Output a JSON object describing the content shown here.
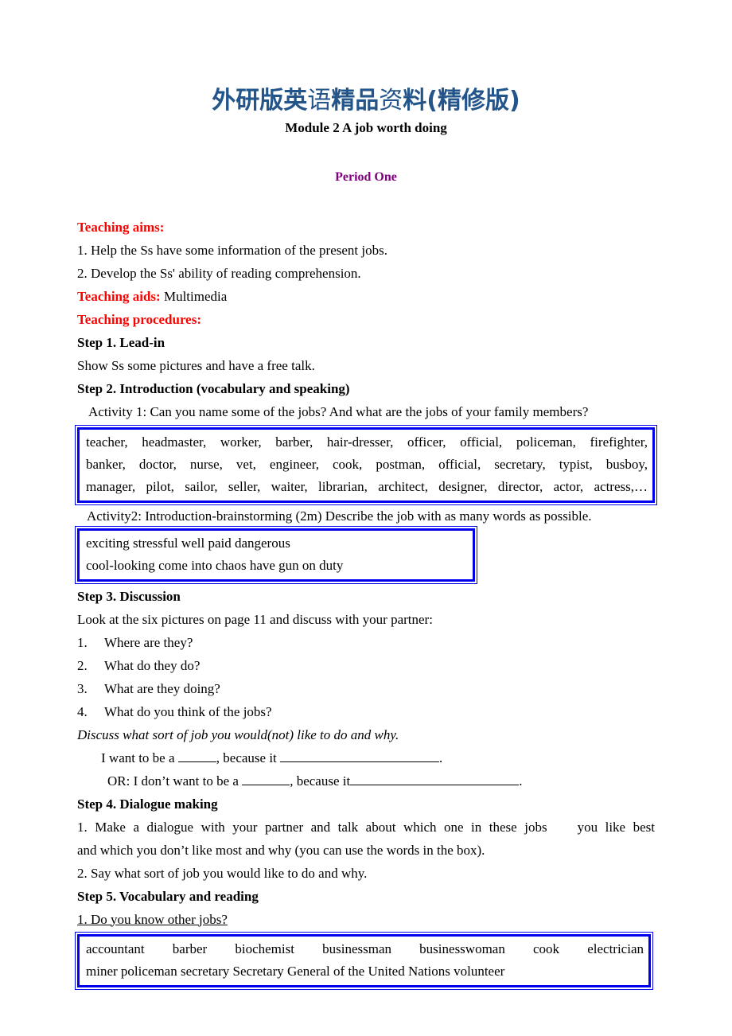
{
  "document": {
    "title_cn": "外研版英语精品资料(精修版)",
    "title_cn_parts": [
      {
        "text": "外研版英",
        "weight": "bold"
      },
      {
        "text": "语",
        "weight": "thin"
      },
      {
        "text": "精品",
        "weight": "bold"
      },
      {
        "text": "资",
        "weight": "thin"
      },
      {
        "text": "料(精修版)",
        "weight": "bold"
      }
    ],
    "module_title": "Module 2 A job worth doing",
    "period": "Period One",
    "colors": {
      "title_blue": "#23558a",
      "heading_red": "#ff0000",
      "period_purple": "#800080",
      "box_border_blue": "#0000ee"
    }
  },
  "teaching_aims": {
    "heading": "Teaching aims:",
    "items": [
      "1. Help the Ss have some information of the present jobs.",
      "2. Develop the Ss' ability of reading comprehension."
    ]
  },
  "teaching_aids": {
    "label": "Teaching aids:",
    "value": "Multimedia"
  },
  "teaching_procedures": {
    "heading": "Teaching procedures:"
  },
  "step1": {
    "heading": "Step 1. Lead-in",
    "body": "Show Ss some pictures and have a free talk."
  },
  "step2": {
    "heading": "Step 2. Introduction (vocabulary and speaking)",
    "activity1": "Activity 1: Can you name some of the jobs? And what are the jobs of your family members?",
    "jobs_box": {
      "line1": "teacher, headmaster, worker, barber, hair-dresser, officer, official, policeman, firefighter,",
      "line2": "banker, doctor, nurse, vet, engineer, cook, postman, official, secretary, typist, busboy,",
      "line3": "manager, pilot, sailor, seller, waiter, librarian, architect, designer, director, actor, actress,…"
    },
    "activity2": "Activity2: Introduction-brainstorming (2m) Describe the job with as many words as possible.",
    "adjectives_box": {
      "line1": "exciting      stressful     well paid     dangerous",
      "line2": "cool-looking   come into chaos     have gun on duty"
    }
  },
  "step3": {
    "heading": "Step 3. Discussion",
    "intro": "Look at the six pictures on page 11 and discuss with your partner:",
    "questions": [
      {
        "num": "1.",
        "text": "Where are they?"
      },
      {
        "num": "2.",
        "text": "What do they do?"
      },
      {
        "num": "3.",
        "text": "What are they doing?"
      },
      {
        "num": "4.",
        "text": "What do you think of the jobs?"
      }
    ],
    "discuss_italic": "Discuss what sort of job you would(not) like to do and why.",
    "fill_in_1_a": "I want to be a ",
    "fill_in_1_b": ", because it ",
    "fill_in_1_c": ".",
    "fill_in_2_a": "OR: I don’t want to be a ",
    "fill_in_2_b": ", because it",
    "fill_in_2_c": "."
  },
  "step4": {
    "heading": "Step 4. Dialogue making",
    "line1": "1. Make a dialogue with your partner and talk about which one in these jobs    you like best",
    "line2": "and which you don’t like most and why (you can use the words in the box).",
    "line3": "2. Say what sort of job you would like to do and why."
  },
  "step5": {
    "heading": "Step 5. Vocabulary and reading",
    "question": "1. Do you know other jobs?",
    "other_jobs_box": {
      "line1": "accountant    barber    biochemist    businessman    businesswoman    cook    electrician",
      "line2": "miner   policeman   secretary   Secretary General of the United Nations   volunteer"
    }
  }
}
